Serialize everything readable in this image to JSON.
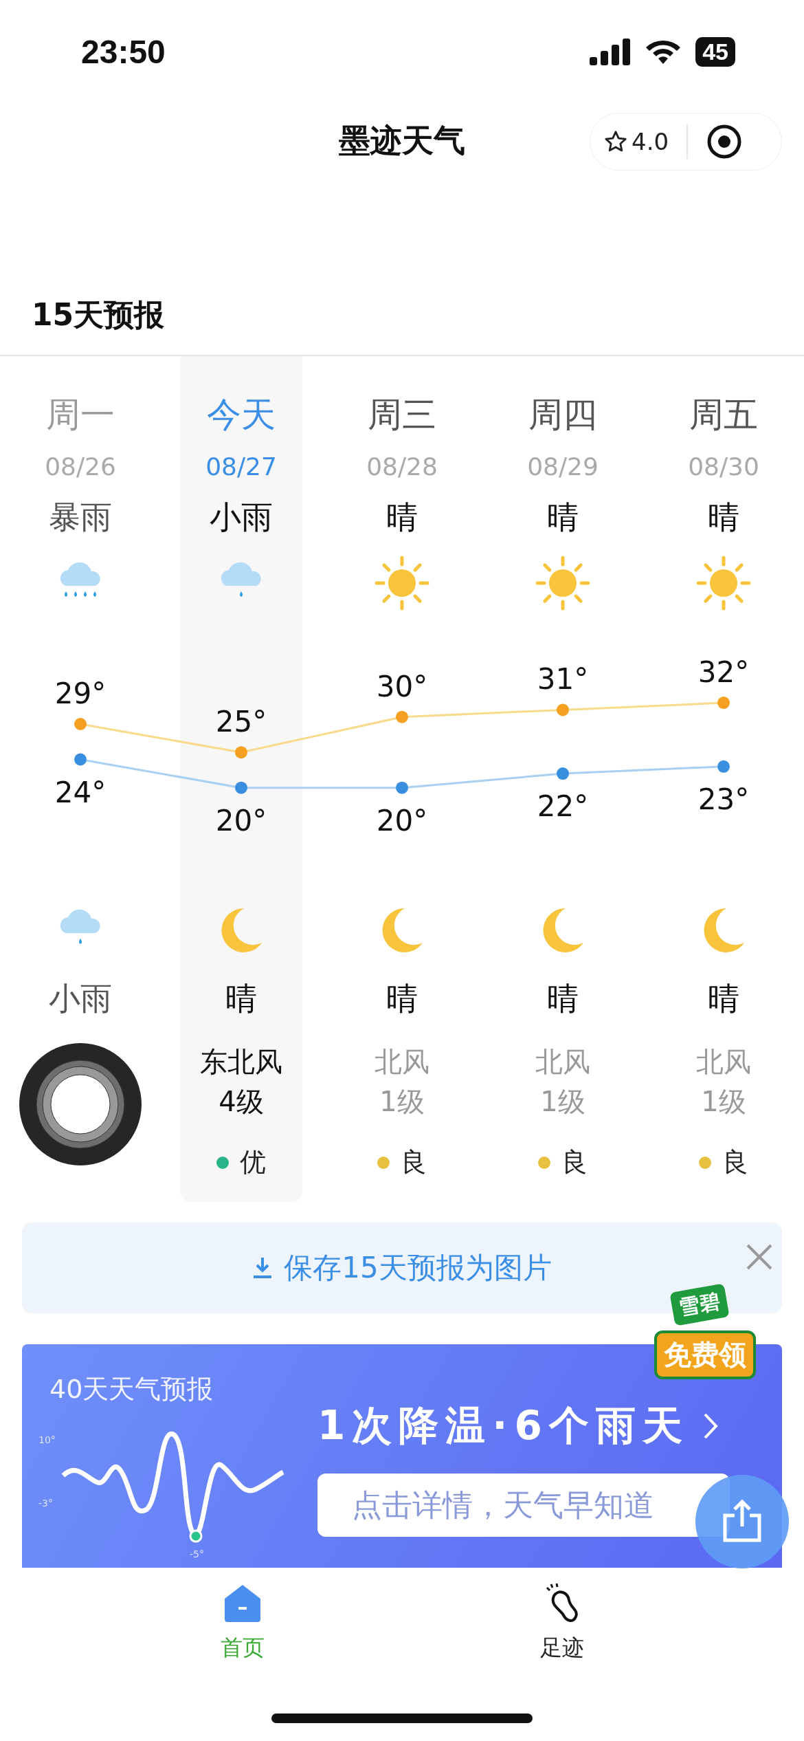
{
  "status_bar": {
    "time": "23:50",
    "battery": "45"
  },
  "nav": {
    "title": "墨迹天气",
    "rating": "4.0"
  },
  "section_title": "15天预报",
  "days": [
    {
      "weekday": "周一",
      "date": "08/26",
      "day": {
        "kind": "heavy_rain",
        "weather": "暴雨"
      },
      "high": "29°",
      "low": "24°",
      "night": {
        "kind": "light_rain",
        "weather": "小雨"
      },
      "selected": false,
      "past": true
    },
    {
      "weekday": "今天",
      "date": "08/27",
      "day": {
        "kind": "light_rain",
        "weather": "小雨"
      },
      "high": "25°",
      "low": "20°",
      "night": {
        "kind": "moon",
        "weather": "晴"
      },
      "wind": "东北风",
      "wind_level": "4级",
      "aqi": "优",
      "color": "#2bb38a",
      "selected": true,
      "past": false
    },
    {
      "weekday": "周三",
      "date": "08/28",
      "day": {
        "kind": "sun",
        "weather": "晴"
      },
      "high": "30°",
      "low": "20°",
      "night": {
        "kind": "moon",
        "weather": "晴"
      },
      "wind": "北风",
      "wind_level": "1级",
      "aqi": "良",
      "color": "#e8c040",
      "selected": false,
      "past": false
    },
    {
      "weekday": "周四",
      "date": "08/29",
      "day": {
        "kind": "sun",
        "weather": "晴"
      },
      "high": "31°",
      "low": "22°",
      "night": {
        "kind": "moon",
        "weather": "晴"
      },
      "wind": "北风",
      "wind_level": "1级",
      "aqi": "良",
      "color": "#e8c040",
      "selected": false,
      "past": false
    },
    {
      "weekday": "周五",
      "date": "08/30",
      "day": {
        "kind": "sun",
        "weather": "晴"
      },
      "high": "32°",
      "low": "23°",
      "night": {
        "kind": "moon",
        "weather": "晴"
      },
      "wind": "北风",
      "wind_level": "1级",
      "aqi": "良",
      "color": "#e8c040",
      "selected": false,
      "past": false
    }
  ],
  "save_button": {
    "label": "保存15天预报为图片"
  },
  "promo": {
    "title": "40天天气预报",
    "wave_labels": [
      "10°",
      "-3°",
      "-5°"
    ],
    "headline": "**1**次降温·**6**个雨天",
    "button": "点击详情，天气早知道"
  },
  "ad_sticker": {
    "brand": "雪碧",
    "label": "免费领"
  },
  "tabs": [
    {
      "label": "首页",
      "selected": true
    },
    {
      "label": "足迹",
      "selected": false
    }
  ]
}
